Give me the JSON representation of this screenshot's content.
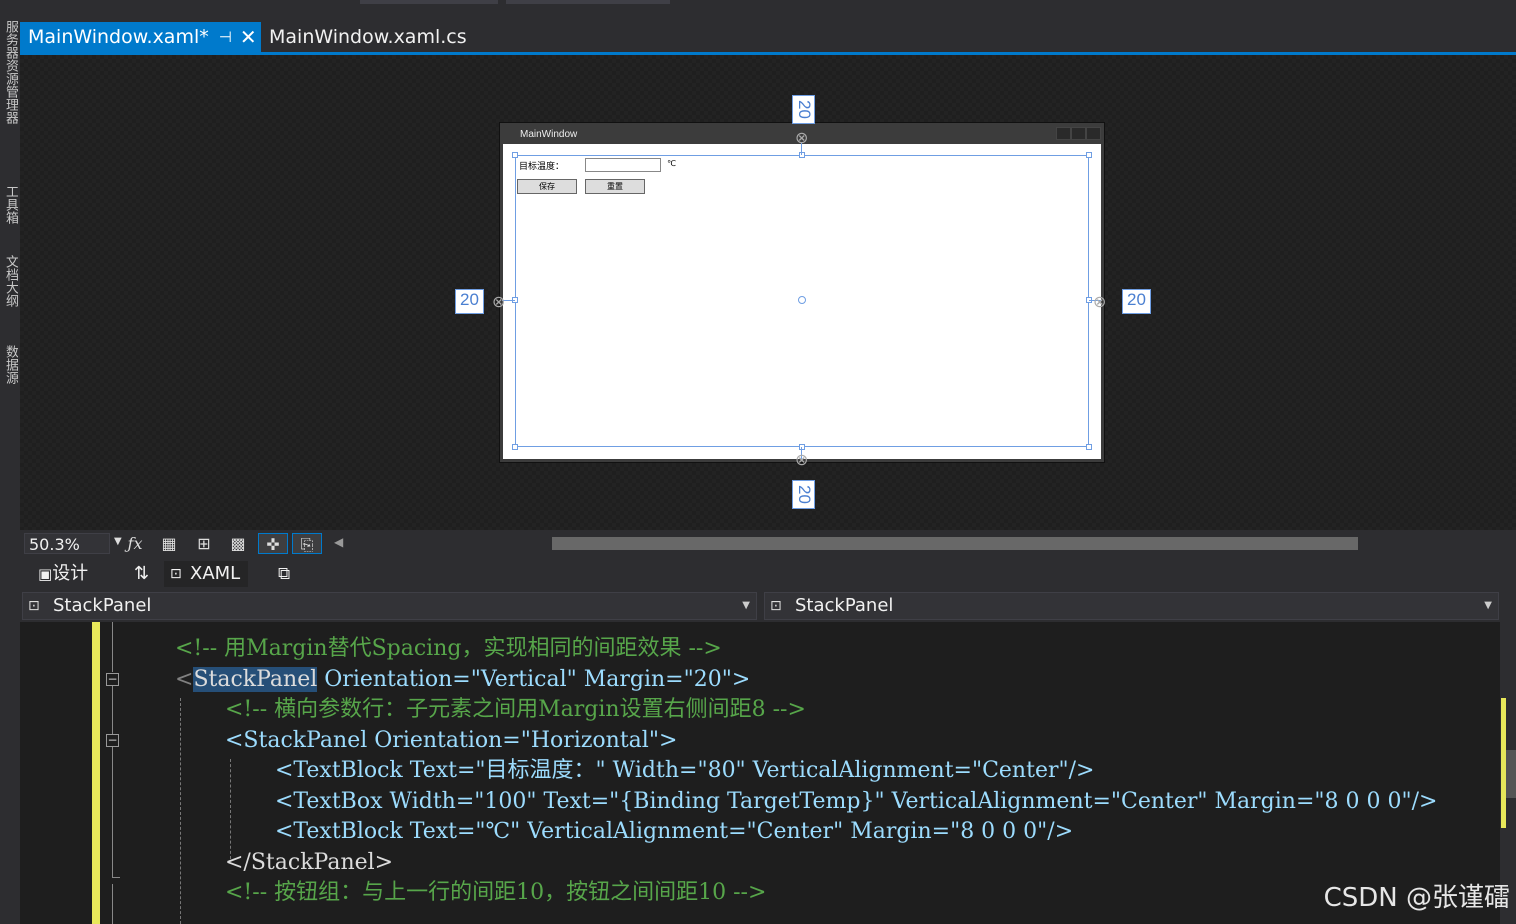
{
  "tabs": [
    {
      "label": "MainWindow.xaml*",
      "active": true
    },
    {
      "label": "MainWindow.xaml.cs",
      "active": false
    }
  ],
  "tab_icons": {
    "pin": "pin-icon",
    "close": "close-icon"
  },
  "designer": {
    "window_title": "MainWindow",
    "label": "目标温度：",
    "unit": "℃",
    "buttons": [
      "保存",
      "重置"
    ],
    "margins": {
      "top": "20",
      "left": "20",
      "right": "20",
      "bottom": "20"
    }
  },
  "toolbar": {
    "zoom": "50.3%",
    "icons": [
      "fx-icon",
      "grid-icon",
      "snap-grid-icon",
      "checker-icon",
      "snap-lines-icon",
      "project-code-icon"
    ]
  },
  "view_switch": {
    "design": "设计",
    "swap": "⇅",
    "xaml": "XAML"
  },
  "dropdowns": {
    "left": "StackPanel",
    "right": "StackPanel"
  },
  "code": {
    "l0": "<!-- 用Margin替代Spacing，实现相同的间距效果 -->",
    "l1_tag": "StackPanel",
    "l1_rest": " Orientation=\"Vertical\" Margin=\"20\">",
    "l2": "<!-- 横向参数行：子元素之间用Margin设置右侧间距8 -->",
    "l3": "<StackPanel Orientation=\"Horizontal\">",
    "l4": "<TextBlock Text=\"目标温度：\" Width=\"80\" VerticalAlignment=\"Center\"/>",
    "l5": "<TextBox Width=\"100\" Text=\"{Binding TargetTemp}\" VerticalAlignment=\"Center\" Margin=\"8 0 0 0\"/>",
    "l6": "<TextBlock Text=\"℃\" VerticalAlignment=\"Center\" Margin=\"8 0 0 0\"/>",
    "l7": "</StackPanel>",
    "l8": "<!-- 按钮组：与上一行的间距10，按钮之间间距10 -->"
  },
  "watermark": "CSDN @张谨礌"
}
